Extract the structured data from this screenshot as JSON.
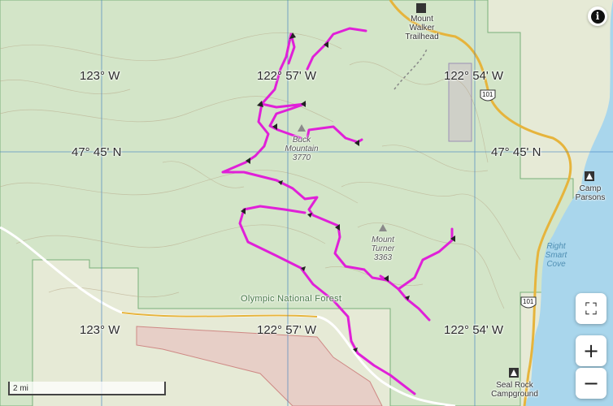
{
  "map": {
    "coordinate_labels": {
      "lon_123_top": "123° W",
      "lon_12257_top": "122° 57' W",
      "lon_12254_top": "122° 54' W",
      "lat_4745_left": "47° 45' N",
      "lat_4745_right": "47° 45' N",
      "lon_123_bottom": "123° W",
      "lon_12257_bottom": "122° 57' W",
      "lon_12254_bottom": "122° 54' W"
    },
    "places": {
      "trailhead_line1": "Mount",
      "trailhead_line2": "Walker",
      "trailhead_line3": "Trailhead",
      "camp_line1": "Camp",
      "camp_line2": "Parsons",
      "seal_line1": "Seal Rock",
      "seal_line2": "Campground"
    },
    "peaks": {
      "buck_line1": "Buck",
      "buck_line2": "Mountain",
      "buck_elev": "3770",
      "turner_line1": "Mount",
      "turner_line2": "Turner",
      "turner_elev": "3363"
    },
    "water": {
      "line1": "Right",
      "line2": "Smart",
      "line3": "Cove"
    },
    "forest_label": "Olympic National Forest",
    "highways": {
      "hwy_top": "101",
      "hwy_bottom": "101"
    },
    "scale_label": "2 mi",
    "colors": {
      "route": "#e020d8",
      "water": "#a9d6ec",
      "forest": "#d3e5c8",
      "grid": "#3f7fc0"
    }
  },
  "controls": {
    "info_label": "i",
    "fullscreen_icon": "⛶",
    "zoom_in": "+",
    "zoom_out": "−"
  }
}
